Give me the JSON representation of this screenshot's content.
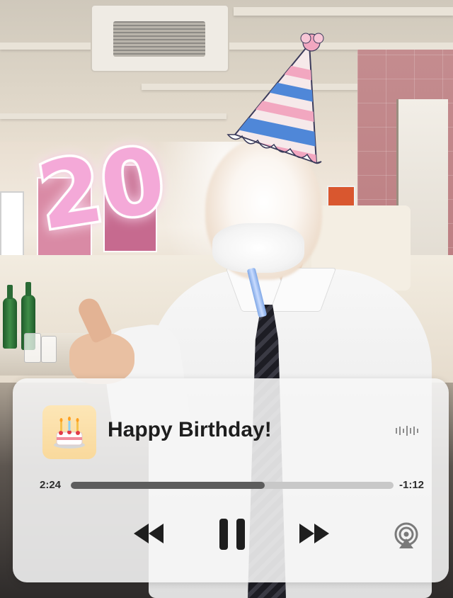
{
  "sticker": {
    "text": "20"
  },
  "player": {
    "title": "Happy Birthday!",
    "artwork_icon": "birthday-cake-icon",
    "elapsed": "2:24",
    "remaining": "-1:12",
    "progress": 0.6,
    "controls": {
      "rewind_icon": "rewind-icon",
      "pause_icon": "pause-icon",
      "forward_icon": "fast-forward-icon",
      "airplay_icon": "airplay-icon",
      "waveform_icon": "waveform-icon"
    }
  },
  "colors": {
    "sticker_pink": "#f4a9d8",
    "sticker_stroke": "#ffffff",
    "player_bg": "#f6f6f6",
    "progress_fill": "#5d5d5d",
    "progress_track": "#c8c8c8",
    "hat_blue": "#4f87d8",
    "hat_pink": "#f2a7c0"
  }
}
